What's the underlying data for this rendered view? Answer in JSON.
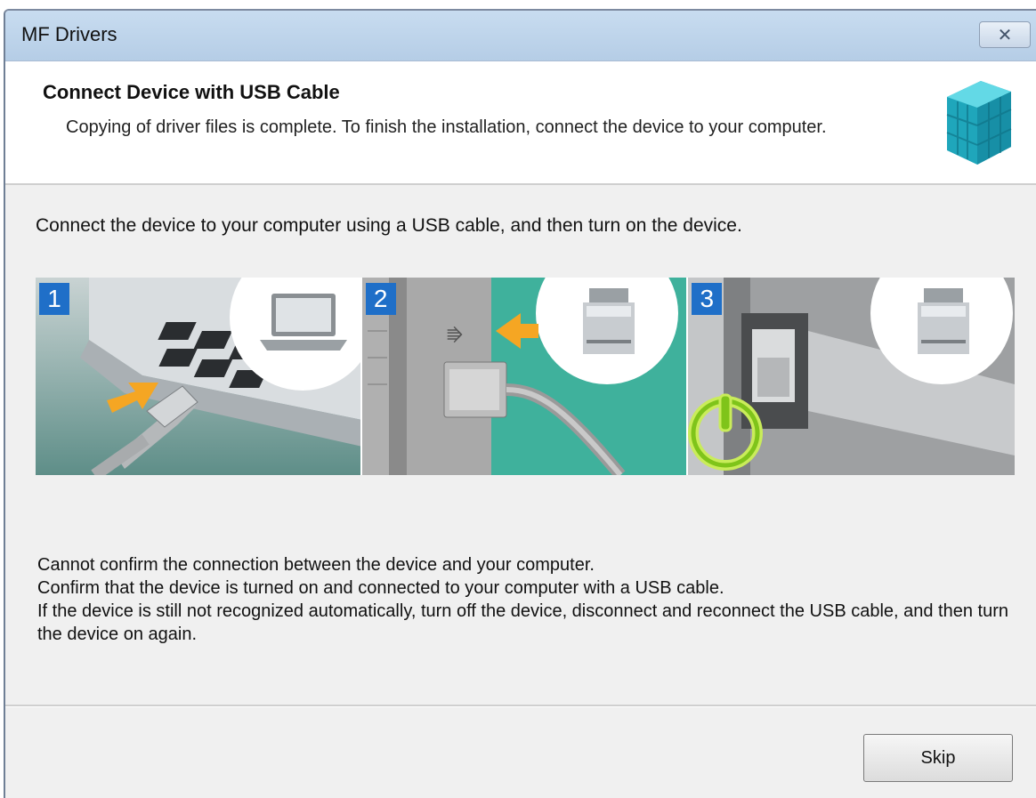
{
  "window": {
    "title": "MF Drivers"
  },
  "header": {
    "title": "Connect Device with USB Cable",
    "description": "Copying of driver files is complete. To finish the installation, connect the device to your computer."
  },
  "instruction": "Connect the device to your computer using a USB cable, and then turn on the device.",
  "steps": [
    {
      "number": "1",
      "icon": "laptop-icon"
    },
    {
      "number": "2",
      "icon": "printer-icon"
    },
    {
      "number": "3",
      "icon": "printer-icon"
    }
  ],
  "message": {
    "line1": "Cannot confirm the connection between the device and your computer.",
    "line2": "Confirm that the device is turned on and connected to your computer with a USB cable.",
    "line3": "If the device is still not recognized automatically, turn off the device, disconnect and reconnect the USB cable, and then turn the device on again."
  },
  "buttons": {
    "skip": "Skip"
  },
  "colors": {
    "step_badge": "#1f6fc8",
    "arrow_orange": "#f5a623",
    "power_green": "#8bd11a",
    "logo_teal": "#2bb5c8"
  }
}
